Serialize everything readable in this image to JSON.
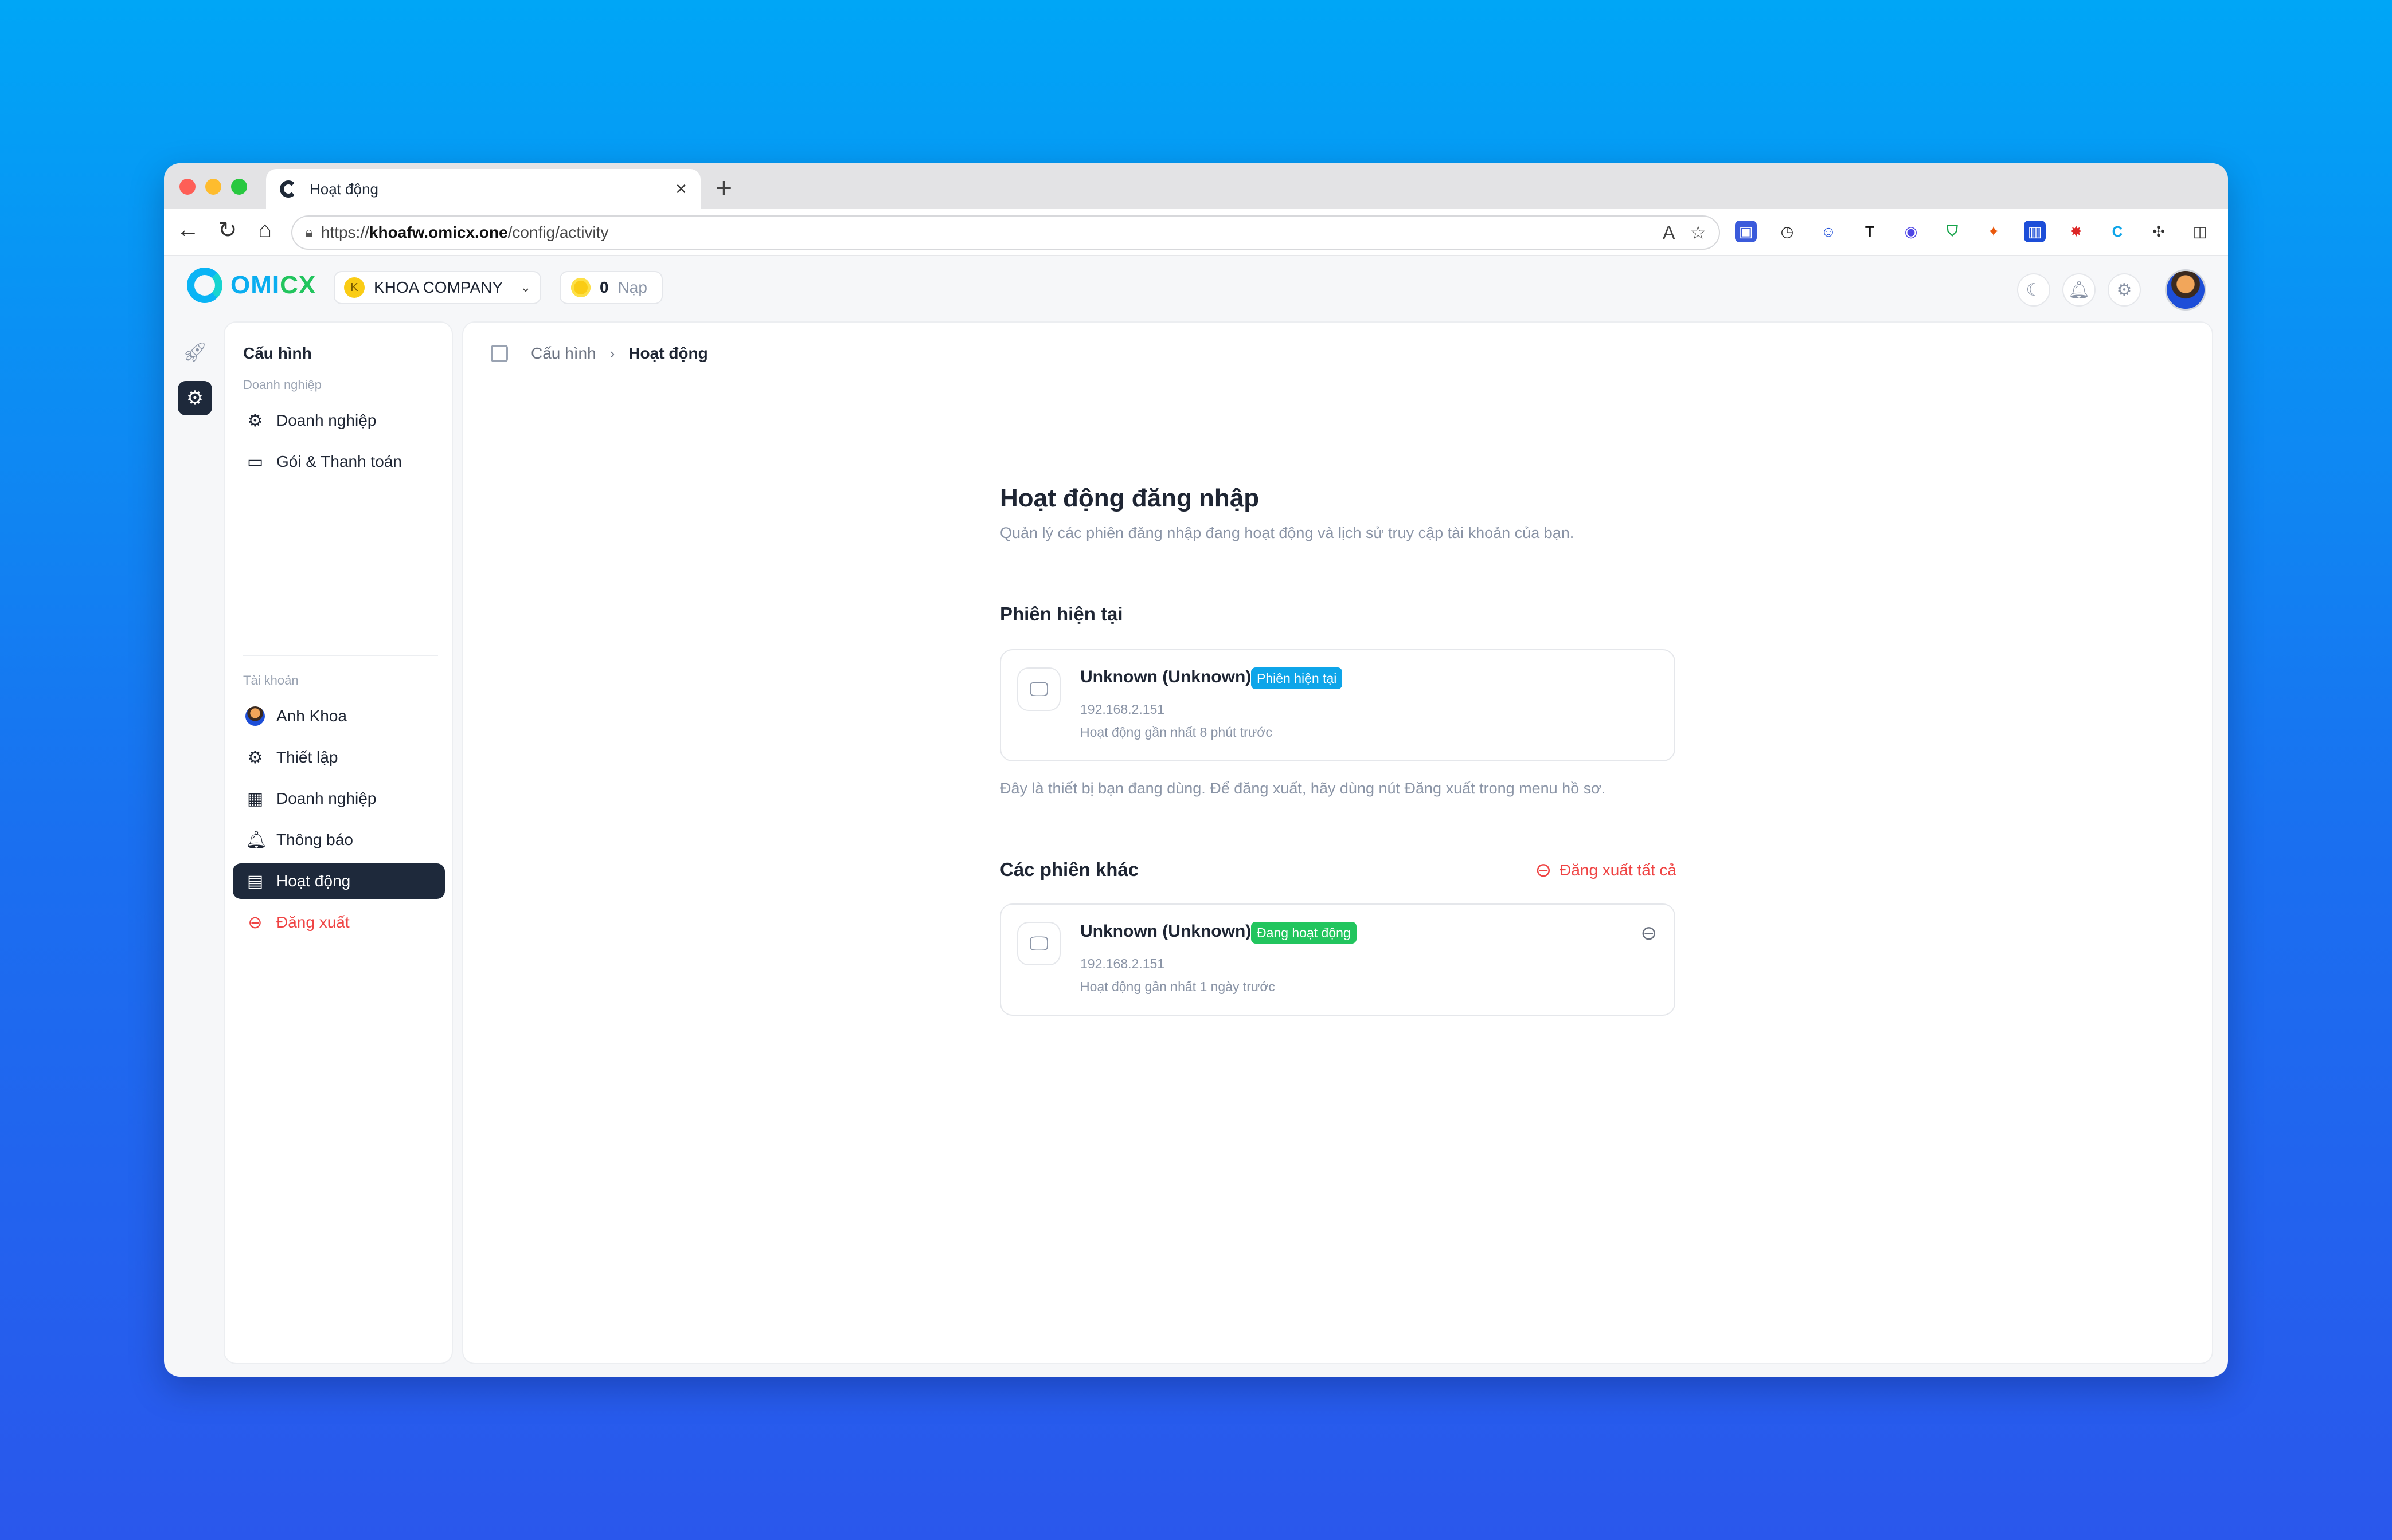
{
  "browser": {
    "tab_title": "Hoạt động",
    "url_prefix": "https://",
    "url_host": "khoafw.omicx.one",
    "url_path": "/config/activity"
  },
  "app": {
    "logo_a": "OMI",
    "logo_b": "CX",
    "company_initial": "K",
    "company_name": "KHOA COMPANY",
    "coin_count": "0",
    "coin_label": "Nạp"
  },
  "sidebar": {
    "title": "Cấu hình",
    "section_business": "Doanh nghiệp",
    "section_account": "Tài khoản",
    "items": [
      {
        "label": "Doanh nghiệp",
        "icon": "gear-icon"
      },
      {
        "label": "Gói & Thanh toán",
        "icon": "card-icon"
      },
      {
        "label": "Anh Khoa",
        "icon": "avatar"
      },
      {
        "label": "Thiết lập",
        "icon": "gear-icon"
      },
      {
        "label": "Doanh nghiệp",
        "icon": "building-icon"
      },
      {
        "label": "Thông báo",
        "icon": "bell-icon"
      },
      {
        "label": "Hoạt động",
        "icon": "activity-icon"
      },
      {
        "label": "Đăng xuất",
        "icon": "logout-icon"
      }
    ]
  },
  "breadcrumb": {
    "parent": "Cấu hình",
    "current": "Hoạt động"
  },
  "page": {
    "title": "Hoạt động đăng nhập",
    "subtitle": "Quản lý các phiên đăng nhập đang hoạt động và lịch sử truy cập tài khoản của bạn.",
    "current_heading": "Phiên hiện tại",
    "current_note": "Đây là thiết bị bạn đang dùng. Để đăng xuất, hãy dùng nút Đăng xuất trong menu hồ sơ.",
    "others_heading": "Các phiên khác",
    "logout_all": "Đăng xuất tất cả"
  },
  "sessions": {
    "current": {
      "device": "Unknown (Unknown)",
      "badge": "Phiên hiện tại",
      "ip": "192.168.2.151",
      "last_active": "Hoạt động gần nhất 8 phút trước"
    },
    "others": [
      {
        "device": "Unknown (Unknown)",
        "badge": "Đang hoạt động",
        "ip": "192.168.2.151",
        "last_active": "Hoạt động gần nhất 1 ngày trước"
      }
    ]
  },
  "colors": {
    "active_nav": "#1e293b",
    "badge_current": "#0ea5e9",
    "badge_active": "#22c55e",
    "danger": "#ef4444"
  }
}
